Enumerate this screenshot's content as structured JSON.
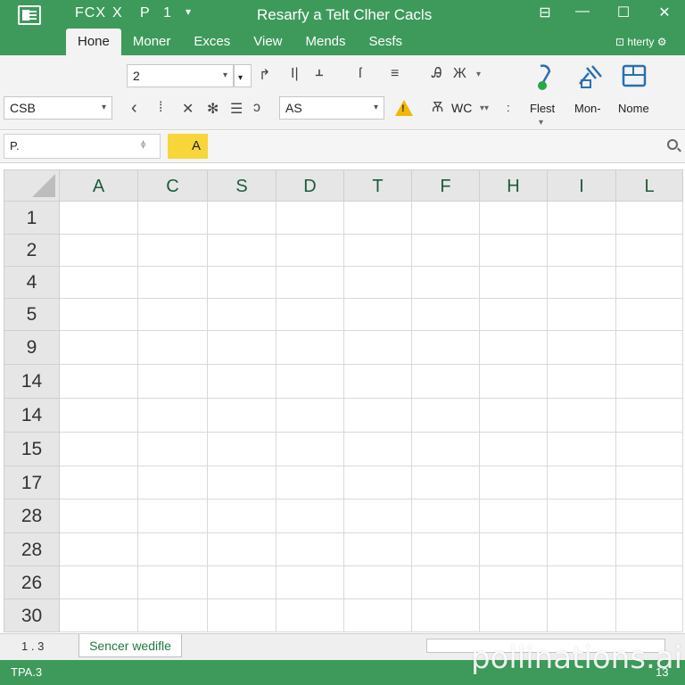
{
  "titlebar": {
    "quick_access": "FCX",
    "qa_x": "X",
    "qa_p": "P",
    "qa_1": "1",
    "qa_caret": "▾",
    "title": "Resarfy a Telt Clher Cacls",
    "ribbon_toggle": "⊟",
    "minimize": "—",
    "maximize": "☐",
    "close": "✕"
  },
  "tabs": [
    {
      "label": "Hone"
    },
    {
      "label": "Moner"
    },
    {
      "label": "Exces"
    },
    {
      "label": "View"
    },
    {
      "label": "Mends"
    },
    {
      "label": "Sesfs"
    }
  ],
  "share": {
    "label": "hterty"
  },
  "ribbon": {
    "font_size": "2",
    "font_name": "CSB",
    "style_box": "AS",
    "wrap_label": "WC",
    "big_buttons": [
      {
        "label": "Flest"
      },
      {
        "label": "Mon-"
      },
      {
        "label": "Nome"
      }
    ],
    "glyphs": {
      "arrow": "↱",
      "bold": "I|",
      "merge": "ᚆ",
      "italic": "ſ",
      "align": "≡",
      "format": "Ꭿ",
      "num": "Ж",
      "chev_left": "‹",
      "pipe": "⁞",
      "clear": "✕",
      "star": "✻",
      "grid": "☰",
      "brush": "ↄ",
      "warn": "!",
      "wrap_icon": "Ѫ",
      "dots": ":"
    }
  },
  "formula_bar": {
    "name_box": "P.",
    "fx": "ᶲ",
    "cell_value": "A"
  },
  "grid": {
    "columns": [
      "A",
      "C",
      "S",
      "D",
      "T",
      "F",
      "H",
      "I",
      "L"
    ],
    "rows": [
      "1",
      "2",
      "4",
      "5",
      "9",
      "14",
      "14",
      "15",
      "17",
      "28",
      "28",
      "26",
      "30"
    ]
  },
  "sheetbar": {
    "nav": "1 . 3",
    "sheet_name": "Sencer wedifle"
  },
  "statusbar": {
    "left": "TPA.3",
    "right": "13"
  },
  "watermark": "pollinations.ai",
  "colors": {
    "accent": "#3e9a5b",
    "highlight": "#f7d63a"
  }
}
